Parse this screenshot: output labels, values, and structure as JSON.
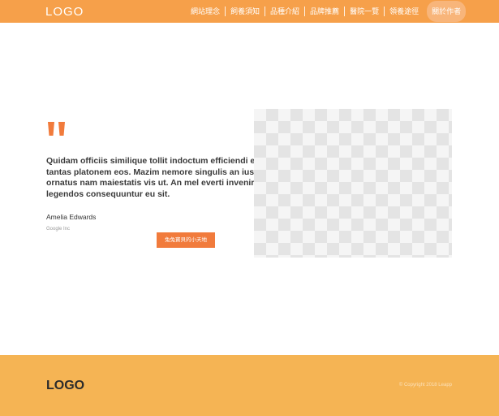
{
  "header": {
    "logo": "LOGO",
    "nav": [
      "網站理念",
      "飼養須知",
      "品種介紹",
      "品牌推薦",
      "醫院一覽",
      "領養途徑",
      "關於作者"
    ],
    "active_index": 6,
    "background": "#f6a04a"
  },
  "main": {
    "quote_icon": "quote-icon",
    "quote": "Quidam officiis similique tollit indoctum efficiendi ei, at nihil tantas platonem eos. Mazim nemore singulis an ius, nullam ornatus nam maiestatis vis ut. An mel everti invenire intellegam, legendos consequuntur eu sit.",
    "author": "Amelia Edwards",
    "company": "Google Inc",
    "cta": "兔兔寶貝的小天地",
    "accent": "#f17b3c"
  },
  "footer": {
    "logo": "LOGO",
    "copyright": "© Copyright 2018 Leapp",
    "background": "#f5b454"
  }
}
